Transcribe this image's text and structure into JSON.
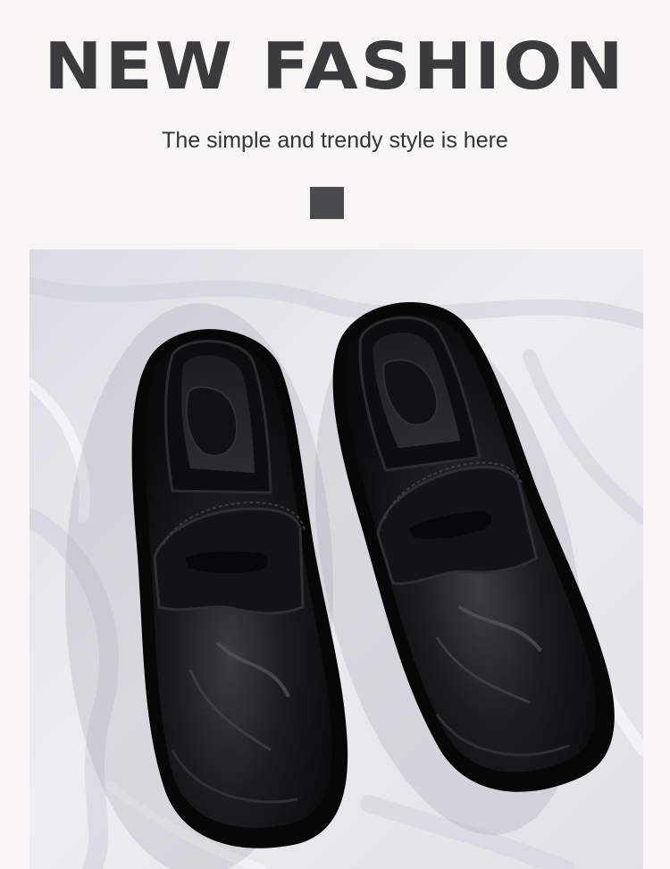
{
  "banner": {
    "headline": "NEW FASHION",
    "subline": "The simple and trendy style is here"
  },
  "colors": {
    "background": "#f7f6f4",
    "headline": "#3b3b3d",
    "accent_square": "#4b4b4e",
    "fabric": "#e3e5ea",
    "leather": "#141416"
  },
  "product_photo": {
    "subject": "pair of black leather penny loafers on white fabric"
  }
}
